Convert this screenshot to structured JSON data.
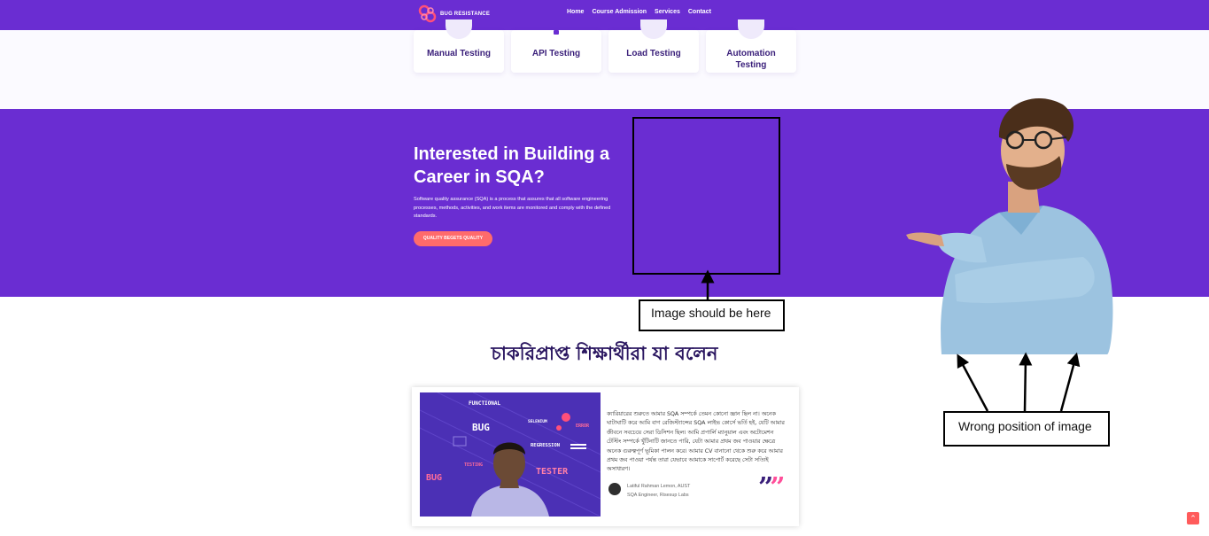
{
  "brand": {
    "name": "BUG RESISTANCE"
  },
  "nav": {
    "items": [
      "Home",
      "Course Admission",
      "Services",
      "Contact"
    ]
  },
  "cards": [
    "Manual Testing",
    "API Testing",
    "Load Testing",
    "Automation Testing"
  ],
  "hero": {
    "title": "Interested in Building a Career in SQA?",
    "description": "Software quality assurance (SQA) is a process that assures that all software engineering processes, methods, activities, and work items are monitored and comply with the defined standards.",
    "button": "QUALITY BEGETS QUALITY"
  },
  "annotations": {
    "target_note": "Image should be here",
    "wrong_note": "Wrong position of image"
  },
  "testimonials": {
    "title": "চাকরিপ্রাপ্ত শিক্ষার্থীরা যা বলেন",
    "image_tags": [
      "FUNCTIONAL",
      "BUG",
      "SELENIUM",
      "ERROR",
      "REGRESSION",
      "TESTING",
      "TESTER",
      "BUG"
    ],
    "quote": "ক্যারিয়ারের শুরুতে আমার SQA সম্পর্কে তেমন কোনো জ্ঞান ছিল না। অনেক ঘাটাঘাটি করে আমি বাগ রেজিস্ট্যান্সের SQA লাইভ কোর্সে ভর্তি হই, যেটি আমার জীবনে সবচেয়ে সেরা ডিসিশন ছিল। আমি প্রপার্লি ম্যানুয়াল এবং অটোমেশন টেস্টিং সম্পর্কে খুঁটিনাটি জানতে পারি, যেটা আমার প্রথম জব পাওয়ার ক্ষেত্রে অনেক গুরুত্বপূর্ণ ভূমিকা পালন করে। আমার CV বানানো থেকে শুরু করে আমার প্রথম জব পাওয়া পর্যন্ত তারা যেভাবে আমাকে সাপোর্ট করেছে সেটা সত্যিই অসাধারণ।",
    "author": "Latiful Rahman Lemon, AUST",
    "role": "SQA Engineer, Risesup Labs",
    "quote_mark": "”",
    "quote_color": "#3a1f7a",
    "quote_accent": "#ff4f9a"
  },
  "scroll_top": {
    "icon": "double-chevron-up-icon",
    "symbol": "⌃"
  },
  "colors": {
    "primary": "#6a2dd2",
    "accent": "#ff6b6b"
  }
}
